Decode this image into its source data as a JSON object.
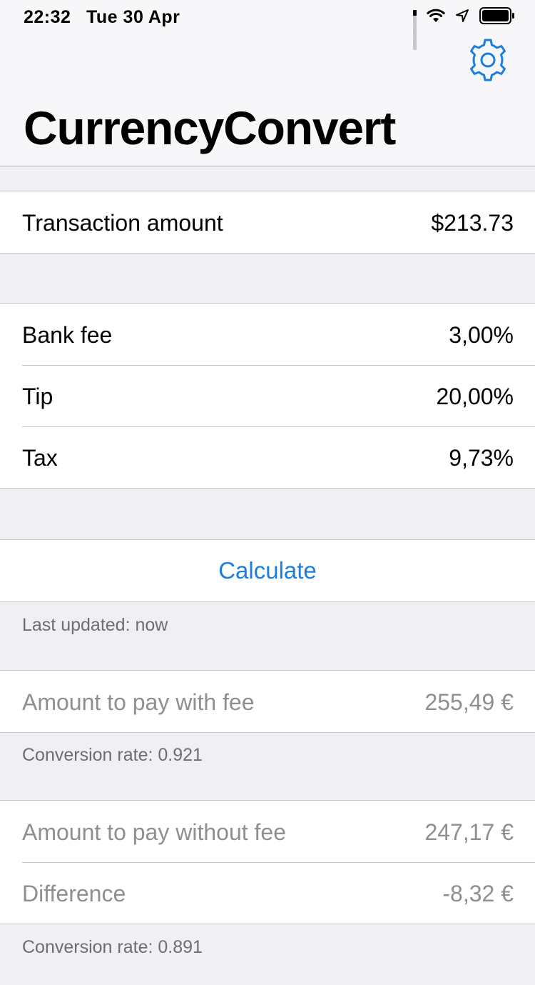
{
  "status_bar": {
    "time": "22:32",
    "date": "Tue 30 Apr"
  },
  "header": {
    "title": "CurrencyConvert",
    "settings_icon": "gear-icon",
    "accent_color": "#1a7fdd"
  },
  "transaction": {
    "label": "Transaction amount",
    "value": "$213.73"
  },
  "fees": [
    {
      "label": "Bank fee",
      "value": "3,00%"
    },
    {
      "label": "Tip",
      "value": "20,00%"
    },
    {
      "label": "Tax",
      "value": "9,73%"
    }
  ],
  "calculate": {
    "label": "Calculate",
    "last_updated": "Last updated: now"
  },
  "with_fee": {
    "label": "Amount to pay with fee",
    "value": "255,49 €",
    "conversion_rate": "Conversion rate: 0.921"
  },
  "without_fee": {
    "rows": [
      {
        "label": "Amount to pay without fee",
        "value": "247,17 €"
      },
      {
        "label": "Difference",
        "value": "-8,32 €"
      }
    ],
    "conversion_rate": "Conversion rate: 0.891"
  }
}
